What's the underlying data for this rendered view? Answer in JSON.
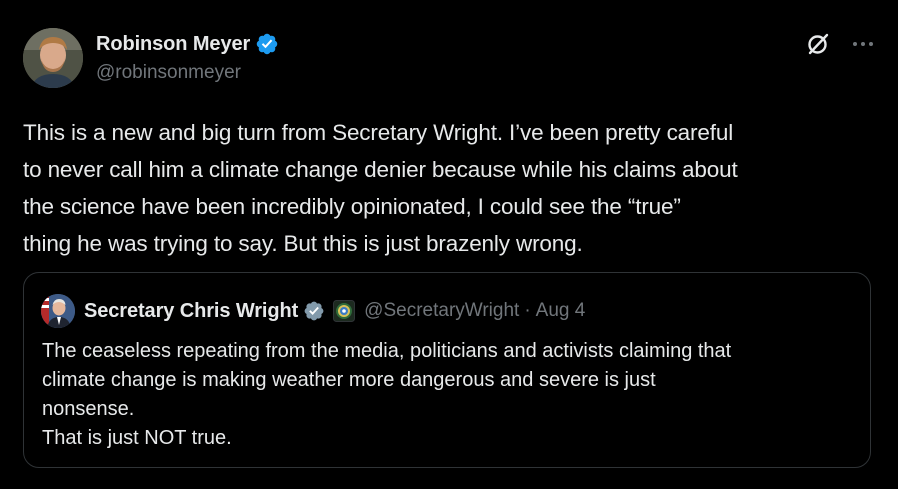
{
  "author": {
    "display_name": "Robinson Meyer",
    "handle": "@robinsonmeyer",
    "verified": true
  },
  "actions": {
    "grok_icon": "grok-icon",
    "more_icon": "more-icon"
  },
  "tweet": {
    "text": "This is a new and big turn from Secretary Wright. I’ve been pretty careful\nto never call him a climate change denier because while his claims about\nthe science have been incredibly opinionated, I could see the “true”\nthing he was trying to say. But this is just brazenly wrong."
  },
  "quote": {
    "display_name": "Secretary Chris Wright",
    "handle": "@SecretaryWright",
    "separator": "·",
    "date": "Aug 4",
    "verified_type": "government",
    "text": "The ceaseless repeating from the media, politicians and activists claiming that\nclimate change is making weather more dangerous and severe is just\nnonsense.\nThat is just NOT true."
  },
  "colors": {
    "background": "#000000",
    "text_primary": "#e7e9ea",
    "text_secondary": "#71767b",
    "border": "#2f3336",
    "verified_blue": "#1d9bf0",
    "verified_gray": "#829aab"
  }
}
